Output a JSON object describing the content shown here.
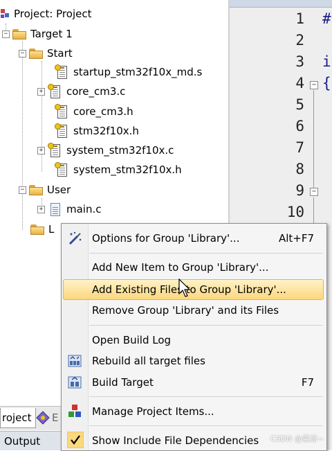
{
  "tree": {
    "project": "Project: Project",
    "target": "Target 1",
    "groups": [
      {
        "name": "Start",
        "files": [
          "startup_stm32f10x_md.s",
          "core_cm3.c",
          "core_cm3.h",
          "stm32f10x.h",
          "system_stm32f10x.c",
          "system_stm32f10x.h"
        ]
      },
      {
        "name": "User",
        "files": [
          "main.c"
        ]
      },
      {
        "name": "L"
      }
    ]
  },
  "editor": {
    "line_numbers": [
      "1",
      "2",
      "3",
      "4",
      "5",
      "6",
      "7",
      "8",
      "9",
      "10"
    ],
    "code_fragments": [
      "#",
      "i",
      "{"
    ]
  },
  "bottom": {
    "tab_project": "roject",
    "tab_books": "E",
    "output_label": "Output"
  },
  "menu": {
    "options": {
      "label": "Options for Group 'Library'...",
      "shortcut": "Alt+F7"
    },
    "add_new": {
      "label": "Add New  Item to Group 'Library'..."
    },
    "add_existing": {
      "label": "Add Existing Files to Group 'Library'..."
    },
    "remove_group": {
      "label": "Remove Group 'Library' and its Files"
    },
    "open_log": {
      "label": "Open Build Log"
    },
    "rebuild": {
      "label": "Rebuild all target files"
    },
    "build": {
      "label": "Build Target",
      "shortcut": "F7"
    },
    "manage": {
      "label": "Manage Project Items..."
    },
    "show_deps": {
      "label": "Show Include File Dependencies"
    }
  },
  "watermark": "CSDN @乘凉~",
  "colors": {
    "highlight": "#fbd77e",
    "folder": "#e7b24a",
    "key": "#f2c21b",
    "output_bar": "#dfe3ea"
  }
}
